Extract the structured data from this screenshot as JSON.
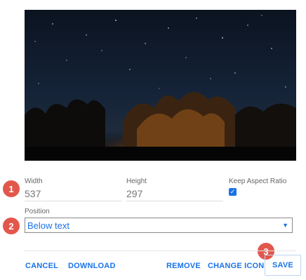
{
  "image": {
    "icon": "night-sky-photo"
  },
  "badges": {
    "one": "1",
    "two": "2",
    "three": "3"
  },
  "fields": {
    "width": {
      "label": "Width",
      "value": "537"
    },
    "height": {
      "label": "Height",
      "value": "297"
    },
    "keep_ratio": {
      "label": "Keep Aspect Ratio",
      "checked": true
    }
  },
  "position": {
    "label": "Position",
    "selected": "Below text"
  },
  "buttons": {
    "cancel": "CANCEL",
    "download": "DOWNLOAD",
    "remove": "REMOVE",
    "change_icon": "CHANGE ICON",
    "save": "SAVE"
  },
  "colors": {
    "accent": "#1a73e8",
    "badge": "#e2574c"
  }
}
